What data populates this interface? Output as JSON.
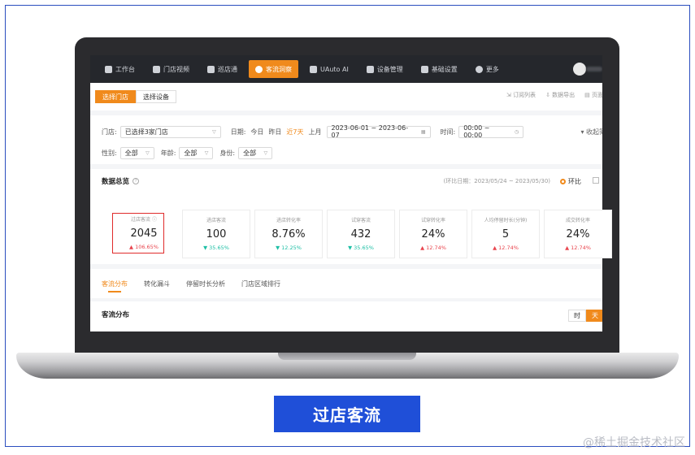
{
  "nav": {
    "items": [
      {
        "label": "工作台",
        "icon": "home-icon"
      },
      {
        "label": "门店视频",
        "icon": "video-icon"
      },
      {
        "label": "巡店通",
        "icon": "clipboard-icon"
      },
      {
        "label": "客流洞察",
        "icon": "user-icon"
      },
      {
        "label": "UAuto AI",
        "icon": "ai-icon"
      },
      {
        "label": "设备管理",
        "icon": "device-icon"
      },
      {
        "label": "基础设置",
        "icon": "settings-icon"
      },
      {
        "label": "更多",
        "icon": "more-icon"
      }
    ],
    "active_index": 3
  },
  "subbar": {
    "seg_store": "选择门店",
    "seg_device": "选择设备",
    "action_subscribe": "订阅列表",
    "action_export": "数据导出",
    "action_page": "页面配"
  },
  "filters": {
    "store_label": "门店:",
    "store_value": "已选择3家门店",
    "date_label": "日期:",
    "quick": [
      "今日",
      "昨日",
      "近7天",
      "上月"
    ],
    "quick_active": "近7天",
    "date_range": "2023-06-01 ~ 2023-06-07",
    "time_label": "时间:",
    "time_range": "00:00 ~ 00:00",
    "gender_label": "性别:",
    "gender_value": "全部",
    "age_label": "年龄:",
    "age_value": "全部",
    "identity_label": "身份:",
    "identity_value": "全部",
    "collapse": "收起筛"
  },
  "overview": {
    "title": "数据总览",
    "compare_range": "(环比日期：2023/05/24 ~ 2023/05/30)",
    "radio_label": "环比",
    "cards": [
      {
        "label": "过店客流 ⓘ",
        "value": "2045",
        "delta": "▲ 106.65%",
        "dir": "up"
      },
      {
        "label": "进店客流",
        "value": "100",
        "delta": "▼ 35.65%",
        "dir": "down"
      },
      {
        "label": "进店转化率",
        "value": "8.76%",
        "delta": "▼ 12.25%",
        "dir": "down"
      },
      {
        "label": "试穿客流",
        "value": "432",
        "delta": "▼ 35.65%",
        "dir": "down"
      },
      {
        "label": "试穿转化率",
        "value": "24%",
        "delta": "▲ 12.74%",
        "dir": "up"
      },
      {
        "label": "人均停留时长(分钟)",
        "value": "5",
        "delta": "▲ 12.74%",
        "dir": "up"
      },
      {
        "label": "成交转化率",
        "value": "24%",
        "delta": "▲ 12.74%",
        "dir": "up"
      }
    ]
  },
  "tabs": [
    "客流分布",
    "转化漏斗",
    "停留时长分析",
    "门店区域排行"
  ],
  "flow": {
    "title": "客流分布",
    "toggle_hour": "时",
    "toggle_day": "天"
  },
  "caption": "过店客流",
  "watermark": "@稀土掘金技术社区",
  "colors": {
    "accent": "#f08a1c",
    "up": "#e8444d",
    "down": "#1dbfa5",
    "caption_bg": "#1f4fd8",
    "highlight": "#e02b2b"
  }
}
